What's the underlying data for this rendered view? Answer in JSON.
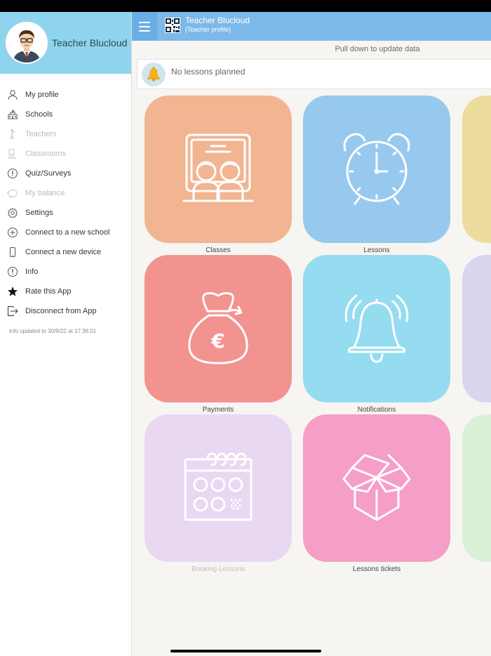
{
  "sidebar": {
    "user_name": "Teacher Blucloud",
    "items": [
      {
        "label": "My profile",
        "icon": "user-icon",
        "disabled": false
      },
      {
        "label": "Schools",
        "icon": "school-icon",
        "disabled": false
      },
      {
        "label": "Teachers",
        "icon": "teacher-icon",
        "disabled": true
      },
      {
        "label": "Classrooms",
        "icon": "classroom-icon",
        "disabled": true
      },
      {
        "label": "Quiz/Surveys",
        "icon": "quiz-icon",
        "disabled": false
      },
      {
        "label": "My balance",
        "icon": "piggy-bank-icon",
        "disabled": true
      },
      {
        "label": "Settings",
        "icon": "gear-icon",
        "disabled": false
      },
      {
        "label": "Connect to a new school",
        "icon": "plus-circle-icon",
        "disabled": false
      },
      {
        "label": "Connect a new device",
        "icon": "phone-icon",
        "disabled": false
      },
      {
        "label": "Info",
        "icon": "info-icon",
        "disabled": false
      },
      {
        "label": "Rate this App",
        "icon": "star-icon",
        "disabled": false
      },
      {
        "label": "Disconnect from App",
        "icon": "logout-icon",
        "disabled": false
      }
    ],
    "updated_text": "info updated to 30/9/22 at 17:36:01"
  },
  "topbar": {
    "title": "Teacher Blucloud",
    "subtitle": "(Teacher profile)"
  },
  "content": {
    "pull_text": "Pull down to update data",
    "notice_text": "No lessons planned"
  },
  "tiles": [
    {
      "label": "Classes",
      "color": "#f1b591",
      "icon": "classes-icon",
      "disabled": false
    },
    {
      "label": "Lessons",
      "color": "#97c9ef",
      "icon": "alarm-clock-icon",
      "disabled": false
    },
    {
      "label": "",
      "color": "#eddc9e",
      "icon": "",
      "disabled": false
    },
    {
      "label": "Payments",
      "color": "#f29390",
      "icon": "money-bag-icon",
      "disabled": false
    },
    {
      "label": "Notifications",
      "color": "#95dcf1",
      "icon": "bell-icon",
      "disabled": false
    },
    {
      "label": "",
      "color": "#d8d5ef",
      "icon": "",
      "disabled": false
    },
    {
      "label": "Booking Lessons",
      "color": "#e8d8f1",
      "icon": "calendar-icon",
      "disabled": true
    },
    {
      "label": "Lessons tickets",
      "color": "#f59ec6",
      "icon": "open-box-icon",
      "disabled": false
    },
    {
      "label": "",
      "color": "#dcefd8",
      "icon": "",
      "disabled": false
    }
  ]
}
